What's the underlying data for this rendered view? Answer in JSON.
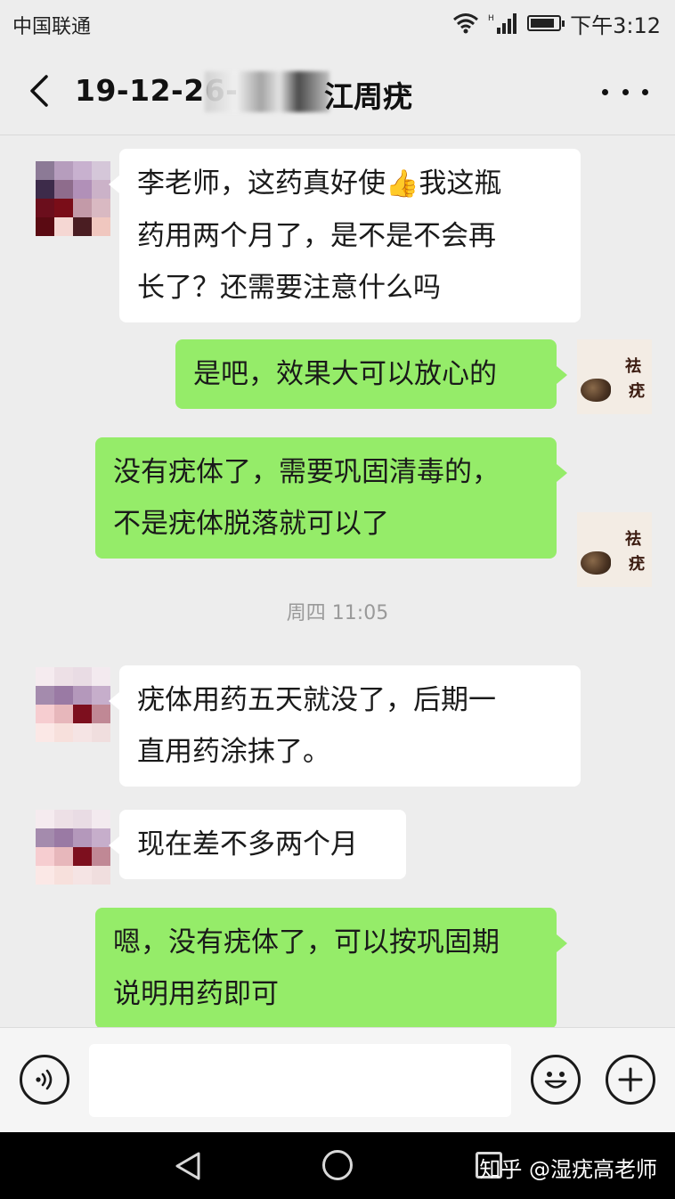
{
  "status_bar": {
    "carrier": "中国联通",
    "time": "下午3:12",
    "battery_level": 0.85
  },
  "nav": {
    "title_prefix": "19-12-26-",
    "title_suffix": "江周疣",
    "back_icon": "chevron-left-icon",
    "more_icon": "more-dots-icon"
  },
  "messages": [
    {
      "from": "contact",
      "lines": [
        "李老师，这药真好使",
        "药用两个月了，是不是不会再",
        "长了？还需要注意什么吗"
      ],
      "emoji": "👍",
      "line1_tail": "我这瓶"
    },
    {
      "from": "self",
      "lines": [
        "是吧，效果大可以放心的"
      ]
    },
    {
      "from": "self",
      "lines": [
        "没有疣体了，需要巩固清毒的，",
        "不是疣体脱落就可以了"
      ]
    },
    {
      "from": "contact",
      "lines": [
        "疣体用药五天就没了，后期一",
        "直用药涂抹了。"
      ]
    },
    {
      "from": "contact",
      "lines": [
        "现在差不多两个月"
      ]
    },
    {
      "from": "self",
      "lines": [
        "嗯，没有疣体了，可以按巩固期",
        "说明用药即可"
      ]
    }
  ],
  "timestamp": "周四 11:05",
  "self_avatar": {
    "glyph_top": "祛",
    "glyph_bottom": "疣"
  },
  "input_bar": {
    "voice_icon": "voice-icon",
    "input_value": "",
    "emoji_icon": "smiley-icon",
    "plus_icon": "plus-icon"
  },
  "watermark": "知乎 @湿疣高老师",
  "colors": {
    "self_bubble": "#95ec69",
    "contact_bubble": "#ffffff",
    "background": "#ededed"
  }
}
